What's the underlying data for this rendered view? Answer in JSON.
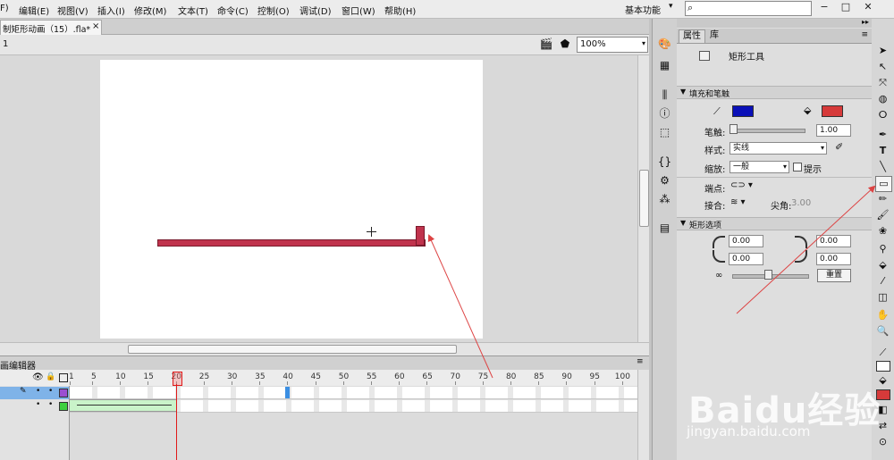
{
  "menu": {
    "items": [
      "F)",
      "编辑(E)",
      "视图(V)",
      "插入(I)",
      "修改(M)",
      "文本(T)",
      "命令(C)",
      "控制(O)",
      "调试(D)",
      "窗口(W)",
      "帮助(H)"
    ],
    "workspace": "基本功能",
    "workspace_arrow": "▾",
    "search_icon": "⌕",
    "minimize": "−",
    "maximize": "□",
    "close": "✕"
  },
  "document": {
    "tab_label": "制矩形动画（15）.fla*",
    "tab_close": "×",
    "scene_number": "1",
    "zoom": "100%",
    "zoom_arrow": "▾"
  },
  "timeline": {
    "title": "画编辑器",
    "menu_icon": "≡",
    "ruler_labels": [
      "1",
      "5",
      "10",
      "15",
      "20",
      "25",
      "30",
      "35",
      "40",
      "45",
      "50",
      "55",
      "60",
      "65",
      "70",
      "75",
      "80",
      "85",
      "90",
      "95",
      "100"
    ],
    "current_frame": 20,
    "selected_frame": 40,
    "tween_start": 1,
    "tween_end": 20,
    "layer_colors": [
      "#9b4fd1",
      "#3fcf3f"
    ]
  },
  "properties": {
    "tab_properties": "属性",
    "tab_library": "库",
    "menu_icon": "≡",
    "collapse_icon": "▸▸",
    "tool_name": "矩形工具",
    "fill_stroke_section": "填充和笔触",
    "stroke_color": "#0a10b8",
    "fill_color": "#d63a3a",
    "stroke_label": "笔触:",
    "stroke_value": "1.00",
    "style_label": "样式:",
    "style_value": "实线",
    "scale_label": "缩放:",
    "scale_value": "一般",
    "hint_label": "提示",
    "cap_label": "端点:",
    "join_label": "接合:",
    "miter_label": "尖角:",
    "miter_value": "3.00",
    "rect_section": "矩形选项",
    "corner_tl": "0.00",
    "corner_tr": "0.00",
    "corner_bl": "0.00",
    "corner_br": "0.00",
    "reset_label": "重置"
  },
  "toolbar": {
    "stroke_swatch": "#ffffff",
    "fill_swatch": "#d63a3a"
  },
  "watermark": {
    "brand": "Baidu经验",
    "url": "jingyan.baidu.com"
  }
}
